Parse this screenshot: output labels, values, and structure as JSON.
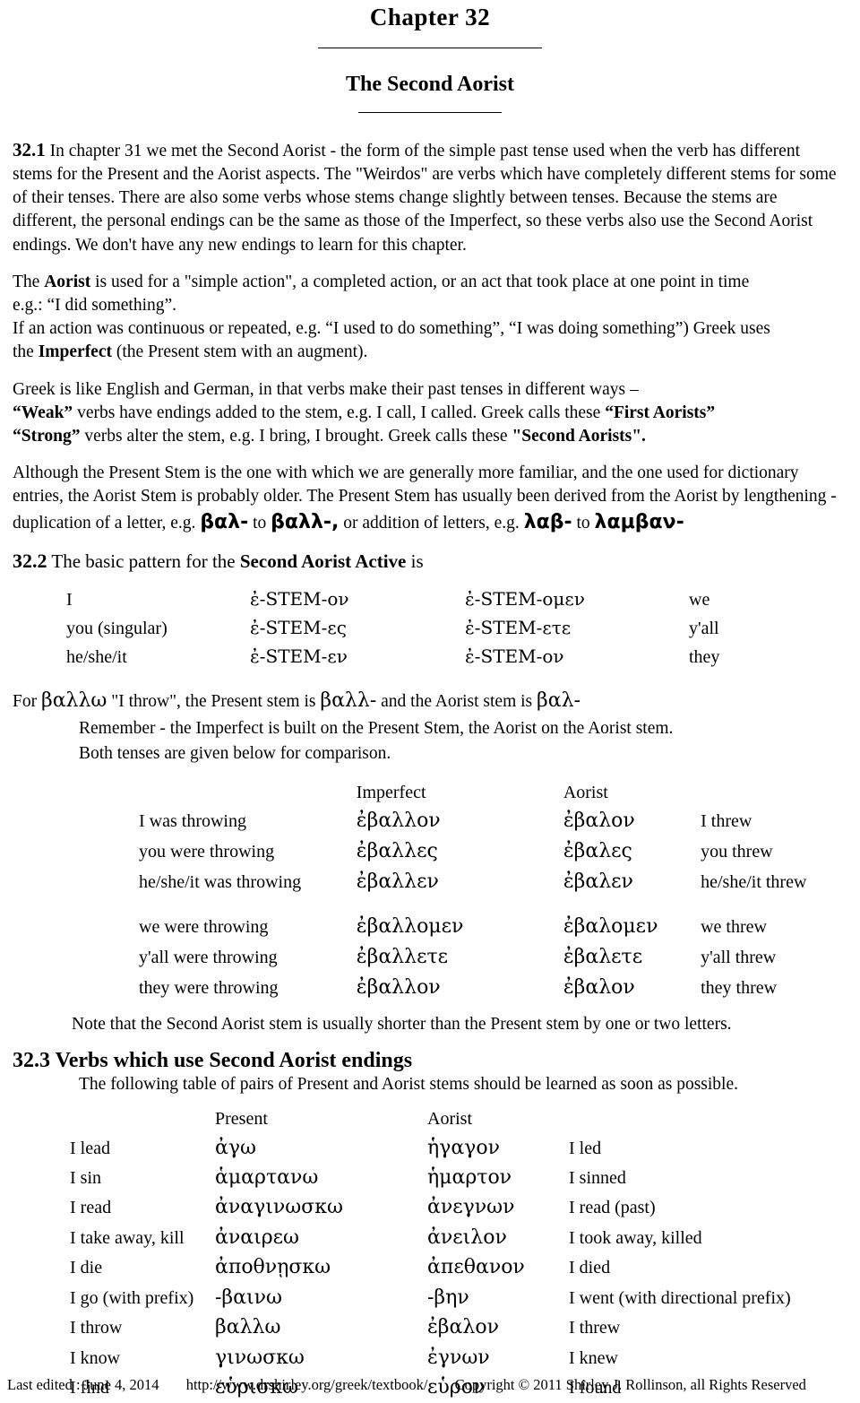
{
  "header": {
    "chapter_title": "Chapter  32",
    "doc_subtitle": "The Second Aorist"
  },
  "section_32_1": {
    "number": "32.1",
    "paragraphs": [
      "In chapter 31 we met the Second Aorist - the form of the simple past tense used when the verb has different stems for the  Present and the Aorist aspects. The \"Weirdos\" are verbs which have completely different stems for some of their tenses. There are also some verbs whose stems change slightly between tenses. Because the stems are different, the personal endings can be the same as those of the Imperfect, so these verbs also use the Second Aorist endings. We don't have any new endings to learn for this chapter.",
      "The Aorist is used for a \"simple action\", a completed action, or an act that took place at one point in time e.g.: “I did something”.",
      "If an action was continuous or repeated, e.g. “I used to do something”, “I was doing something”) Greek uses the Imperfect (the Present stem with an augment).",
      "Greek is like English and German, in that verbs make their past tenses in different ways –",
      "“Weak” verbs have endings added to the stem, e.g.  I call, I called. Greek calls these “First Aorists”",
      "“Strong” verbs alter the stem, e.g.  I bring, I brought.  Greek calls these  \"Second Aorists\".",
      "Although the Present Stem is the one with which we are generally more familiar, and the one used for dictionary entries, the Aorist Stem is probably older.  The Present Stem has usually been derived from the Aorist by lengthening - duplication of a letter, e.g.  βαλ-  to  βαλλ-,  or addition of letters, e.g.  λαβ-  to  λαμβαν-"
    ],
    "inline": {
      "aorist_bold": "Aorist",
      "imperfect_bold": "Imperfect",
      "weak_bold": "“Weak”",
      "strong_bold": "“Strong”",
      "first_aorists_bold": "“First Aorists”",
      "second_aorists_bold": "\"Second Aorists\".",
      "gk_bal": "βαλ-",
      "gk_ballo": "βαλλ-,",
      "gk_lab": "λαβ-",
      "gk_lamban": "λαμβαν-"
    }
  },
  "section_32_2": {
    "number": "32.2",
    "heading_pre": "The basic pattern for the ",
    "heading_bold": "Second Aorist  Active",
    "heading_post": " is",
    "paradigm": [
      {
        "pronoun": "I",
        "singular": "ἐ-STEM-ον",
        "plural": "ἐ-STEM-ομεν",
        "pronoun_pl": "we"
      },
      {
        "pronoun": "you (singular)",
        "singular": "ἐ-STEM-ες",
        "plural": "ἐ-STEM-ετε",
        "pronoun_pl": "y'all"
      },
      {
        "pronoun": "he/she/it",
        "singular": "ἐ-STEM-εν",
        "plural": "ἐ-STEM-ον",
        "pronoun_pl": "they"
      }
    ],
    "for_line": "For  βαλλω  \"I throw\", the Present stem is  βαλλ-  and the Aorist stem is  βαλ-",
    "for_line_parts": {
      "for": "For",
      "ballo": "βαλλω",
      "gloss": "\"I throw\", the Present stem is",
      "pres_stem": "βαλλ-",
      "mid": "and the Aorist stem is",
      "aor_stem": "βαλ-"
    },
    "remember_line": "Remember - the Imperfect is built on the Present Stem, the Aorist on the Aorist stem.",
    "both_line": "Both tenses are given below for comparison.",
    "comparison": {
      "col_head_imperfect": "Imperfect",
      "col_head_aorist": "Aorist",
      "rows": [
        {
          "eng_left": "I was throwing",
          "imperfect": "ἐβαλλον",
          "aorist": "ἐβαλον",
          "eng_right": "I threw"
        },
        {
          "eng_left": "you were throwing",
          "imperfect": "ἐβαλλες",
          "aorist": "ἐβαλες",
          "eng_right": "you threw"
        },
        {
          "eng_left": "he/she/it was throwing",
          "imperfect": "ἐβαλλεν",
          "aorist": "ἐβαλεν",
          "eng_right": "he/she/it threw"
        }
      ],
      "rows2": [
        {
          "eng_left": "we were throwing",
          "imperfect": "ἐβαλλομεν",
          "aorist": "ἐβαλομεν",
          "eng_right": "we threw"
        },
        {
          "eng_left": "y'all were throwing",
          "imperfect": "ἐβαλλετε",
          "aorist": "ἐβαλετε",
          "eng_right": "y'all threw"
        },
        {
          "eng_left": "they were throwing",
          "imperfect": "ἐβαλλον",
          "aorist": "ἐβαλον",
          "eng_right": "they threw"
        }
      ],
      "note": "Note that the Second Aorist stem is usually shorter than the Present stem by one or two letters."
    }
  },
  "section_32_3": {
    "number": "32.3",
    "heading": "Verbs which use Second Aorist  endings",
    "subheading": "The following table of pairs of Present and Aorist stems should be learned as soon as possible.",
    "col_head_present": "Present",
    "col_head_aorist": "Aorist",
    "verbs": [
      {
        "eng_present": "I lead",
        "present": "ἀγω",
        "aorist": "ἡγαγον",
        "eng_aorist": "I led"
      },
      {
        "eng_present": "I sin",
        "present": "ἁμαρτανω",
        "aorist": "ἡμαρτον",
        "eng_aorist": "I sinned"
      },
      {
        "eng_present": "I read",
        "present": "ἀναγινωσκω",
        "aorist": "ἀνεγνων",
        "eng_aorist": "I read (past)"
      },
      {
        "eng_present": "I take away, kill",
        "present": "ἀναιρεω",
        "aorist": "ἀνειλον",
        "eng_aorist": "I took away, killed"
      },
      {
        "eng_present": "I die",
        "present": "ἀποθνῃσκω",
        "aorist": "ἀπεθανον",
        "eng_aorist": "I died"
      },
      {
        "eng_present": "I go (with prefix)",
        "present": "-βαινω",
        "aorist": "-βην",
        "eng_aorist": "I went (with directional prefix)"
      },
      {
        "eng_present": "I throw",
        "present": "βαλλω",
        "aorist": "ἐβαλον",
        "eng_aorist": "I threw"
      },
      {
        "eng_present": "I know",
        "present": "γινωσκω",
        "aorist": "ἐγνων",
        "eng_aorist": "I knew"
      },
      {
        "eng_present": "I find",
        "present": "εὑρισκω",
        "aorist": "εὑρον",
        "eng_aorist": "I found"
      }
    ]
  },
  "footer": {
    "last_edited": "Last edited : June 4, 2014",
    "url": "http://www.drshirley.org/greek/textbook/",
    "copyright": "Copyright © 2011 Shirley J. Rollinson, all Rights Reserved"
  }
}
